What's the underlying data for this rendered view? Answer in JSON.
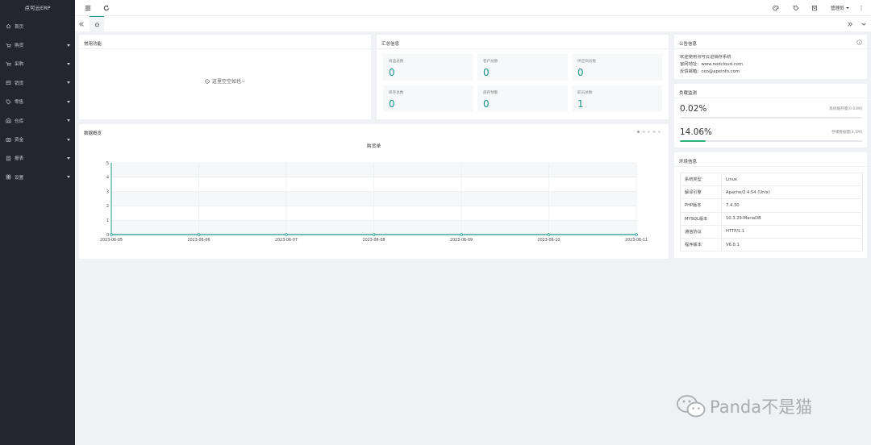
{
  "app": {
    "logo": "点可云ERP"
  },
  "sidebar": {
    "items": [
      {
        "label": "首页",
        "icon": "home-icon",
        "has_arrow": false
      },
      {
        "label": "购货",
        "icon": "cart-icon",
        "has_arrow": true
      },
      {
        "label": "采购",
        "icon": "cart-icon",
        "has_arrow": true
      },
      {
        "label": "销货",
        "icon": "box-icon",
        "has_arrow": true
      },
      {
        "label": "零售",
        "icon": "tag-icon",
        "has_arrow": true
      },
      {
        "label": "仓库",
        "icon": "warehouse-icon",
        "has_arrow": true
      },
      {
        "label": "资金",
        "icon": "money-icon",
        "has_arrow": true
      },
      {
        "label": "报表",
        "icon": "report-icon",
        "has_arrow": true
      },
      {
        "label": "设置",
        "icon": "grid-icon",
        "has_arrow": true
      }
    ]
  },
  "header": {
    "menu_icon": "menu-icon",
    "refresh_icon": "refresh-icon",
    "right_icons": [
      "palette-icon",
      "tag-icon",
      "calendar-icon"
    ],
    "user": "管理员",
    "more_icon": "more-vertical-icon"
  },
  "tabs": {
    "prev_icon": "double-chevron-left-icon",
    "home_icon": "home-icon",
    "next_icon": "double-chevron-right-icon",
    "menu_icon": "chevron-down-icon"
  },
  "common": {
    "title": "常用功能",
    "empty_text": "这里空空如也~"
  },
  "summary": {
    "title": "汇总信息",
    "stats": [
      {
        "label": "商品总数",
        "value": "0"
      },
      {
        "label": "客户总数",
        "value": "0"
      },
      {
        "label": "供应商总数",
        "value": "0"
      },
      {
        "label": "库存总数",
        "value": "0"
      },
      {
        "label": "库存预警",
        "value": "0"
      },
      {
        "label": "职员总数",
        "value": "1"
      }
    ]
  },
  "overview": {
    "title": "数据概览",
    "dots": 5,
    "active_dot": 0
  },
  "notice": {
    "title": "公告信息",
    "lines": [
      "欢迎使用点可云进销存系统",
      "官网地址：www.nodcloud.com",
      "反馈邮箱：ceo@apeinfo.com"
    ]
  },
  "load": {
    "title": "负载监测",
    "items": [
      {
        "value": "0.02%",
        "label": "系统缓存量[0.03M]",
        "fraction": 0.0002
      },
      {
        "value": "14.06%",
        "label": "存储数据量[4.5M]",
        "fraction": 0.1406
      }
    ]
  },
  "env": {
    "title": "环境信息",
    "rows": [
      {
        "key": "系统类型",
        "value": "Linux"
      },
      {
        "key": "解译引擎",
        "value": "Apache/2.4.54 (Unix)"
      },
      {
        "key": "PHP版本",
        "value": "7.4.30"
      },
      {
        "key": "MYSQL版本",
        "value": "10.3.29-MariaDB"
      },
      {
        "key": "通信协议",
        "value": "HTTP/1.1"
      },
      {
        "key": "程序版本",
        "value": "V6.0.1"
      }
    ]
  },
  "watermark": {
    "text": "Panda不是猫"
  },
  "colors": {
    "accent": "#1a9b8b",
    "sidebar": "#23262e",
    "progress": "#2fb17b"
  },
  "chart_data": {
    "type": "line",
    "title": "购货单",
    "categories": [
      "2023-06-05",
      "2023-06-06",
      "2023-06-07",
      "2023-06-08",
      "2023-06-09",
      "2023-06-10",
      "2023-06-11"
    ],
    "series": [
      {
        "values": [
          0,
          0,
          0,
          0,
          0,
          0,
          0
        ]
      }
    ],
    "ylim": [
      0,
      5
    ],
    "yticks": [
      "0",
      "1",
      "2",
      "3",
      "4",
      "5"
    ],
    "xlabel": "",
    "ylabel": "",
    "grid": true
  }
}
